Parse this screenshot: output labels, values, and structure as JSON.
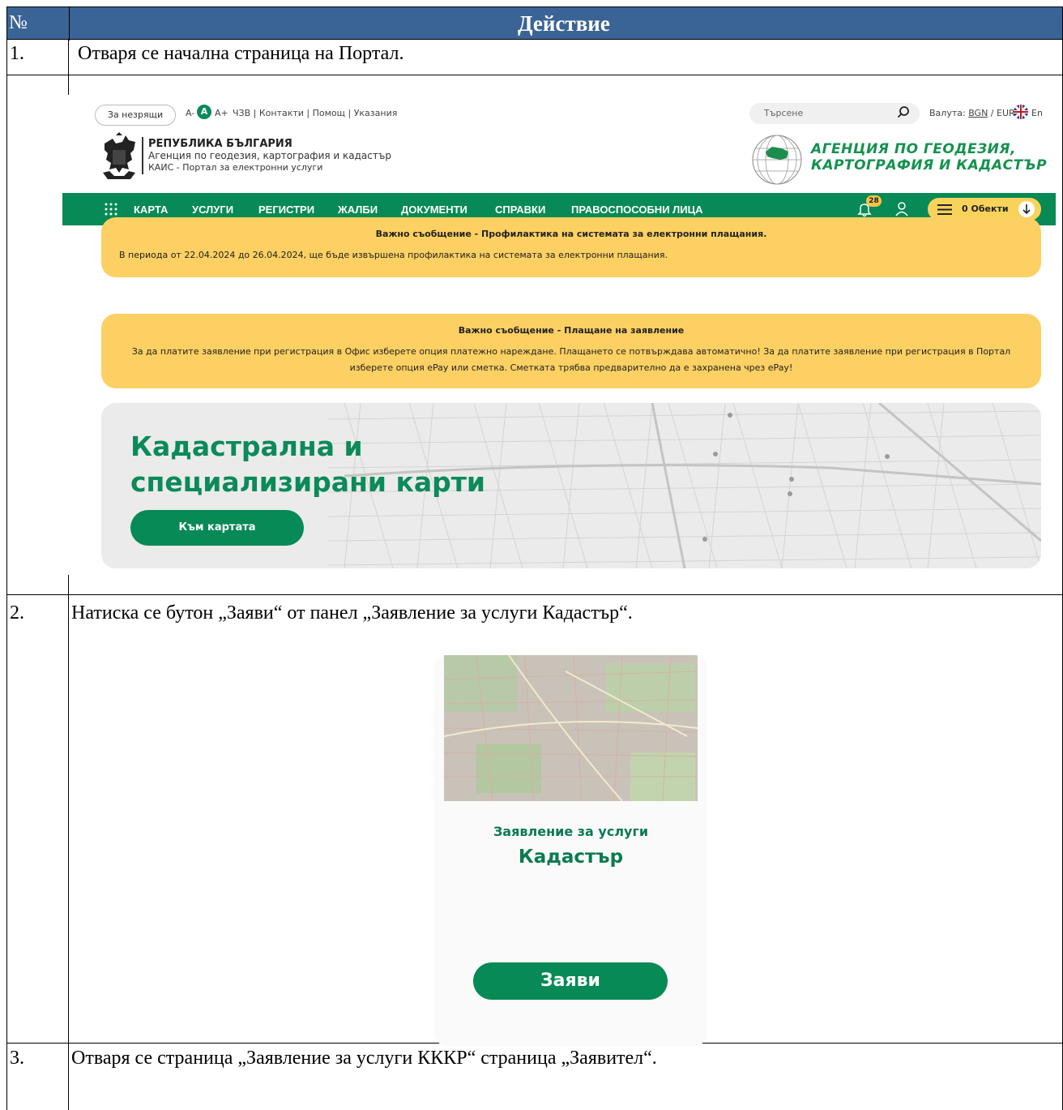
{
  "table": {
    "col_no": "№",
    "col_action": "Действие"
  },
  "rows": [
    {
      "num": "1.",
      "text": "Отваря се начална страница на Портал."
    },
    {
      "num": "2.",
      "text": "Натиска се бутон „Заяви“ от панел „Заявление за услуги Кадастър“."
    },
    {
      "num": "3.",
      "text": "Отваря се страница „Заявление за услуги КККР“ страница „Заявител“."
    }
  ],
  "portal": {
    "ua_button": "За незрящи",
    "font_small": "A-",
    "font_normal": "A",
    "font_large": "A+",
    "top_links": "ЧЗВ | Контакти | Помощ | Указания",
    "search_placeholder": "Търсене",
    "currency_label": "Валута:",
    "currency_bgn": "BGN",
    "currency_eur": "/ EUR",
    "language": "En",
    "republic": "РЕПУБЛИКА БЪЛГАРИЯ",
    "agency_subtitle": "Агенция по геодезия, картография и кадастър",
    "portal_subtitle": "КАИС - Портал за електронни услуги",
    "logo_line1": "АГЕНЦИЯ ПО ГЕОДЕЗИЯ,",
    "logo_line2": "КАРТОГРАФИЯ И КАДАСТЪР",
    "nav": [
      "КАРТА",
      "УСЛУГИ",
      "РЕГИСТРИ",
      "ЖАЛБИ",
      "ДОКУМЕНТИ",
      "СПРАВКИ",
      "ПРАВОСПОСОБНИ ЛИЦА"
    ],
    "notifications_count": "28",
    "cart_label": "0 Обекти",
    "notice1_title": "Важно съобщение - Профилактика на системата за електронни плащания.",
    "notice1_body": "В периода от 22.04.2024 до 26.04.2024, ще бъде извършена профилактика на системата за електронни плащания.",
    "notice2_title": "Важно съобщение - Плащане на заявление",
    "notice2_body": "За да платите заявление при регистрация в Офис изберете опция  платежно нареждане. Плащането се потвърждава автоматично! За да платите заявление при регистрация в Портал изберете опция ePay или сметка. Сметката трябва предварително да е захранена чрез ePay!",
    "hero_line1": "Кадастрална и",
    "hero_line2": "специализирани карти",
    "hero_button": "Към картата"
  },
  "card": {
    "line1": "Заявление за услуги",
    "line2": "Кадастър",
    "button": "Заяви"
  },
  "colors": {
    "header_blue": "#3a6496",
    "portal_green": "#078a55",
    "notice_yellow": "#fcd062"
  }
}
